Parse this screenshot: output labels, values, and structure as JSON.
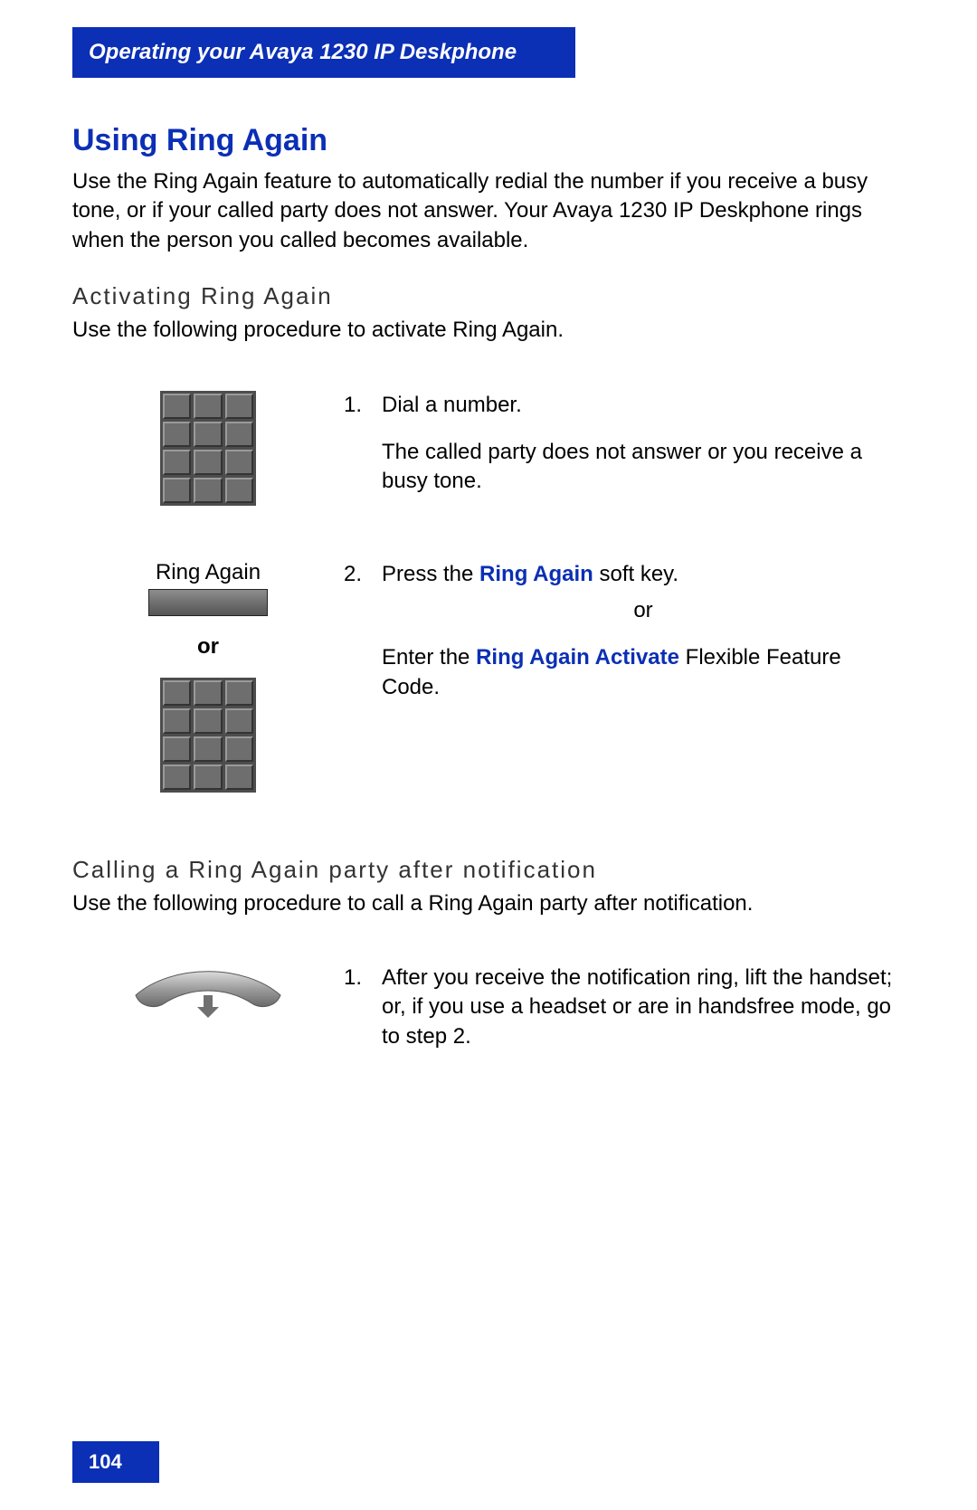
{
  "header": "Operating your Avaya 1230 IP Deskphone",
  "title": "Using Ring Again",
  "intro": "Use the Ring Again feature to automatically redial the number if you receive a busy tone, or if your called party does not answer. Your Avaya 1230 IP Deskphone rings when the person you called becomes available.",
  "section1": {
    "heading": "Activating Ring Again",
    "intro": "Use the following procedure to activate Ring Again.",
    "softkey_label": "Ring Again",
    "or_label": "or",
    "step1_num": "1.",
    "step1_text": "Dial a number.",
    "step1_sub": "The called party does not answer or you receive a busy tone.",
    "step2_num": "2.",
    "step2_prefix": "Press the ",
    "step2_bold": "Ring Again",
    "step2_suffix": " soft key.",
    "step2_or": "or",
    "step2b_prefix": "Enter the ",
    "step2b_bold": "Ring Again Activate",
    "step2b_suffix": " Flexible Feature Code."
  },
  "section2": {
    "heading": "Calling a Ring Again party after notification",
    "intro": "Use the following procedure to call a Ring Again party after notification.",
    "step1_num": "1.",
    "step1_text": "After you receive the notification ring, lift the handset; or, if you use a headset or are in handsfree mode, go to step 2."
  },
  "page_number": "104"
}
